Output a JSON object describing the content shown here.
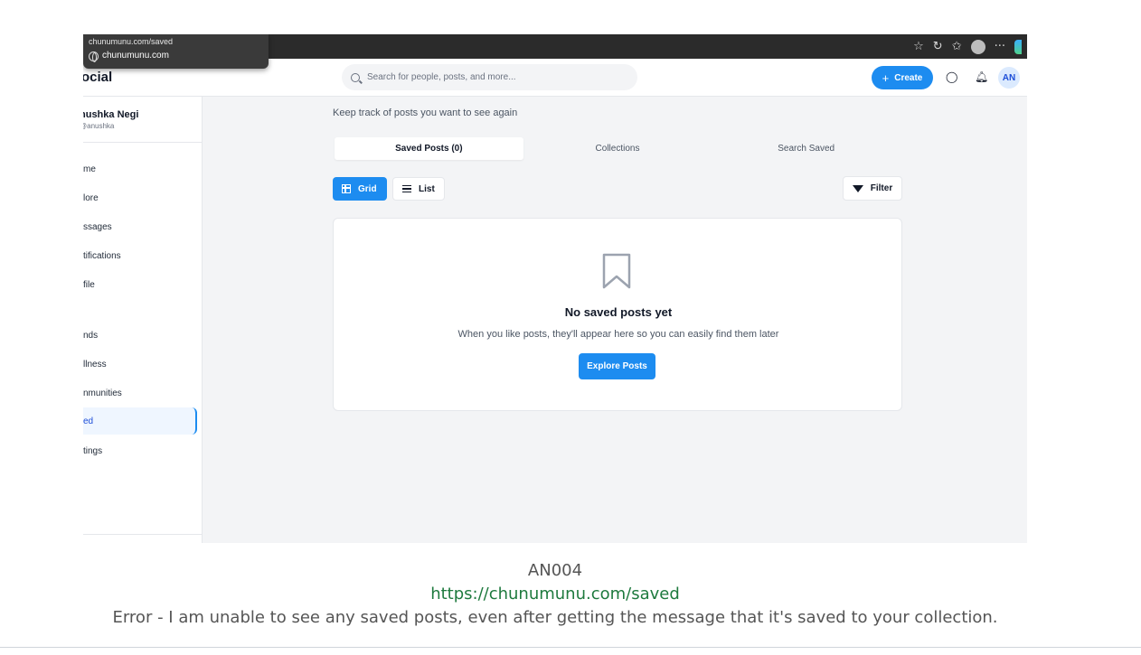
{
  "browser": {
    "tooltip_url": "chunumunu.com/saved",
    "tooltip_site": "chunumunu.com",
    "more_label": "···"
  },
  "header": {
    "brand": "ocial",
    "search_placeholder": "Search for people, posts, and more...",
    "create_label": "Create",
    "avatar_initials": "AN"
  },
  "sidebar": {
    "user_name": "nushka Negi",
    "user_handle": "@anushka",
    "items": [
      {
        "label": "me"
      },
      {
        "label": "lore"
      },
      {
        "label": "ssages"
      },
      {
        "label": "tifications"
      },
      {
        "label": "file"
      },
      {
        "label": "nds"
      },
      {
        "label": "llness"
      },
      {
        "label": "nmunities"
      },
      {
        "label": "ed"
      },
      {
        "label": "tings"
      }
    ]
  },
  "main": {
    "subtitle": "Keep track of posts you want to see again",
    "tabs": [
      {
        "label": "Saved Posts (0)"
      },
      {
        "label": "Collections"
      },
      {
        "label": "Search Saved"
      }
    ],
    "grid_label": "Grid",
    "list_label": "List",
    "filter_label": "Filter",
    "empty_title": "No saved posts yet",
    "empty_desc": "When you like posts, they'll appear here so you can easily find them later",
    "explore_label": "Explore Posts"
  },
  "caption": {
    "id": "AN004",
    "url": "https://chunumunu.com/saved",
    "error": "Error - I am unable to see any saved posts, even after getting the message that it's saved to your collection."
  },
  "colors": {
    "accent": "#1d8cf0",
    "url_green": "#1e7a3e"
  }
}
